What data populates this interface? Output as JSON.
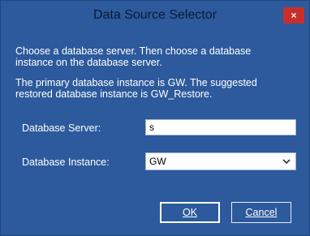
{
  "window": {
    "title": "Data Source Selector",
    "close_glyph": "×"
  },
  "instructions": {
    "line1": "Choose a database server.  Then choose a database instance on the database server.",
    "line2": "The primary database instance is GW.  The suggested restored database instance is GW_Restore."
  },
  "form": {
    "server_label": "Database Server:",
    "server_value": "s",
    "instance_label": "Database Instance:",
    "instance_value": "GW"
  },
  "buttons": {
    "ok_label": "OK",
    "cancel_label": "Cancel"
  },
  "colors": {
    "window_background": "#2c5a9c",
    "close_button": "#c7302a"
  }
}
